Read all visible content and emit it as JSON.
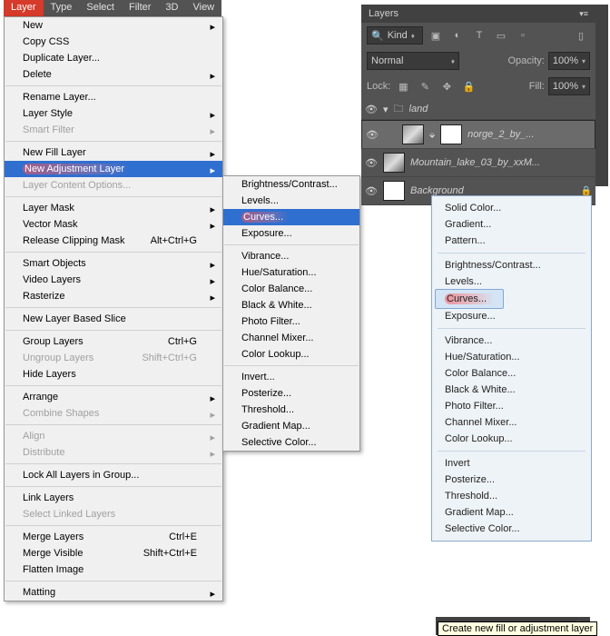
{
  "menubar": {
    "items": [
      "Layer",
      "Type",
      "Select",
      "Filter",
      "3D",
      "View"
    ],
    "active": "Layer"
  },
  "layerMenu": {
    "groups": [
      [
        {
          "label": "New",
          "arrow": true
        },
        {
          "label": "Copy CSS"
        },
        {
          "label": "Duplicate Layer..."
        },
        {
          "label": "Delete",
          "arrow": true
        }
      ],
      [
        {
          "label": "Rename Layer..."
        },
        {
          "label": "Layer Style",
          "arrow": true
        },
        {
          "label": "Smart Filter",
          "arrow": true,
          "disabled": true
        }
      ],
      [
        {
          "label": "New Fill Layer",
          "arrow": true
        },
        {
          "label": "New Adjustment Layer",
          "arrow": true,
          "hl": true,
          "red": true
        },
        {
          "label": "Layer Content Options...",
          "disabled": true
        }
      ],
      [
        {
          "label": "Layer Mask",
          "arrow": true
        },
        {
          "label": "Vector Mask",
          "arrow": true
        },
        {
          "label": "Release Clipping Mask",
          "shortcut": "Alt+Ctrl+G"
        }
      ],
      [
        {
          "label": "Smart Objects",
          "arrow": true
        },
        {
          "label": "Video Layers",
          "arrow": true
        },
        {
          "label": "Rasterize",
          "arrow": true
        }
      ],
      [
        {
          "label": "New Layer Based Slice"
        }
      ],
      [
        {
          "label": "Group Layers",
          "shortcut": "Ctrl+G"
        },
        {
          "label": "Ungroup Layers",
          "shortcut": "Shift+Ctrl+G",
          "disabled": true
        },
        {
          "label": "Hide Layers"
        }
      ],
      [
        {
          "label": "Arrange",
          "arrow": true
        },
        {
          "label": "Combine Shapes",
          "arrow": true,
          "disabled": true
        }
      ],
      [
        {
          "label": "Align",
          "arrow": true,
          "disabled": true
        },
        {
          "label": "Distribute",
          "arrow": true,
          "disabled": true
        }
      ],
      [
        {
          "label": "Lock All Layers in Group..."
        }
      ],
      [
        {
          "label": "Link Layers"
        },
        {
          "label": "Select Linked Layers",
          "disabled": true
        }
      ],
      [
        {
          "label": "Merge Layers",
          "shortcut": "Ctrl+E"
        },
        {
          "label": "Merge Visible",
          "shortcut": "Shift+Ctrl+E"
        },
        {
          "label": "Flatten Image"
        }
      ],
      [
        {
          "label": "Matting",
          "arrow": true
        }
      ]
    ]
  },
  "adjSubmenu": {
    "groups": [
      [
        {
          "label": "Brightness/Contrast..."
        },
        {
          "label": "Levels..."
        },
        {
          "label": "Curves...",
          "hl": true,
          "red": true
        },
        {
          "label": "Exposure..."
        }
      ],
      [
        {
          "label": "Vibrance..."
        },
        {
          "label": "Hue/Saturation..."
        },
        {
          "label": "Color Balance..."
        },
        {
          "label": "Black & White..."
        },
        {
          "label": "Photo Filter..."
        },
        {
          "label": "Channel Mixer..."
        },
        {
          "label": "Color Lookup..."
        }
      ],
      [
        {
          "label": "Invert..."
        },
        {
          "label": "Posterize..."
        },
        {
          "label": "Threshold..."
        },
        {
          "label": "Gradient Map..."
        },
        {
          "label": "Selective Color..."
        }
      ]
    ]
  },
  "panel": {
    "title": "Layers",
    "kind": "Kind",
    "blend": "Normal",
    "opacityLabel": "Opacity:",
    "opacityVal": "100%",
    "lockLabel": "Lock:",
    "fillLabel": "Fill:",
    "fillVal": "100%",
    "layers": [
      {
        "type": "group",
        "name": "land"
      },
      {
        "type": "layer",
        "name": "norge_2_by_...",
        "selected": true,
        "hasMask": true
      },
      {
        "type": "layer",
        "name": "Mountain_lake_03_by_xxM..."
      },
      {
        "type": "bg",
        "name": "Background"
      }
    ]
  },
  "adjPopup": {
    "groups": [
      [
        "Solid Color...",
        "Gradient...",
        "Pattern..."
      ],
      [
        "Brightness/Contrast...",
        "Levels...",
        "Curves...",
        "Exposure..."
      ],
      [
        "Vibrance...",
        "Hue/Saturation...",
        "Color Balance...",
        "Black & White...",
        "Photo Filter...",
        "Channel Mixer...",
        "Color Lookup..."
      ],
      [
        "Invert",
        "Posterize...",
        "Threshold...",
        "Gradient Map...",
        "Selective Color..."
      ]
    ],
    "selected": "Curves..."
  },
  "tooltip": "Create new fill or adjustment layer"
}
